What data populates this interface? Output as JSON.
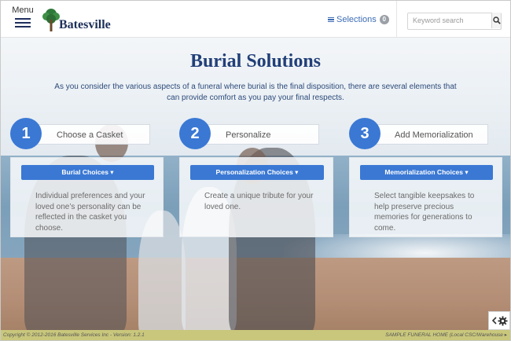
{
  "header": {
    "menu_label": "Menu",
    "brand_name": "Batesville",
    "selections_label": "Selections",
    "selections_count": "0",
    "search_placeholder": "Keyword search"
  },
  "hero": {
    "title": "Burial Solutions",
    "intro": "As you consider the various aspects of a funeral where burial is the final disposition, there are several elements that can provide comfort as you pay your final respects."
  },
  "steps": [
    {
      "number": "1",
      "title": "Choose a Casket",
      "button": "Burial Choices ▾",
      "description": "Individual preferences and your loved one’s personality can be reflected in the casket you choose."
    },
    {
      "number": "2",
      "title": "Personalize",
      "button": "Personalization Choices ▾",
      "description": "Create a unique tribute for your loved one."
    },
    {
      "number": "3",
      "title": "Add Memorialization",
      "button": "Memorialization Choices ▾",
      "description": "Select tangible keepsakes to help preserve precious memories for generations to come."
    }
  ],
  "footer": {
    "copyright": "Copyright © 2012-2016 Batesville Services Inc - Version: 1.2.1",
    "location": "SAMPLE FUNERAL HOME (Local CSC/Warehouse ▸"
  },
  "colors": {
    "accent": "#3a78d4",
    "brand_navy": "#1d2f58",
    "footer_bar": "#c9c77c"
  },
  "icons": [
    "hamburger-icon",
    "tree-logo-icon",
    "list-icon",
    "search-icon",
    "code-icon",
    "gear-icon"
  ]
}
